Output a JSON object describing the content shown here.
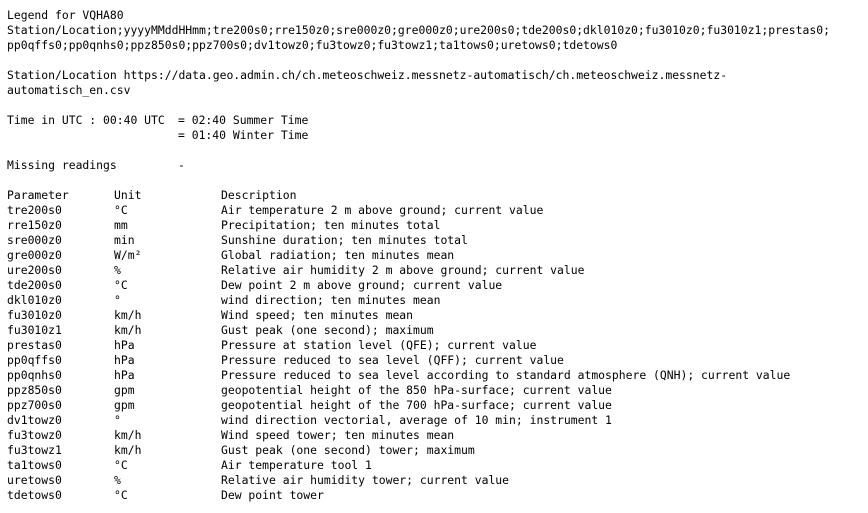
{
  "legend_title": "Legend for VQHA80",
  "station_format_line1": "Station/Location;yyyyMMddHHmm;tre200s0;rre150z0;sre000z0;gre000z0;ure200s0;tde200s0;dkl010z0;fu3010z0;fu3010z1;prestas0;",
  "station_format_line2": "pp0qffs0;pp0qnhs0;ppz850s0;ppz700s0;dv1towz0;fu3towz0;fu3towz1;ta1tows0;uretows0;tdetows0",
  "station_location_line1": "Station/Location https://data.geo.admin.ch/ch.meteoschweiz.messnetz-automatisch/ch.meteoschweiz.messnetz-",
  "station_location_line2": "automatisch_en.csv",
  "time": {
    "label": "Time in UTC : 00:40 UTC",
    "summer": "= 02:40 Summer Time",
    "winter": "= 01:40 Winter Time"
  },
  "missing": {
    "label": "Missing readings",
    "value": "-"
  },
  "table": {
    "headers": {
      "parameter": "Parameter",
      "unit": "Unit",
      "description": "Description"
    },
    "rows": [
      {
        "parameter": "tre200s0",
        "unit": "°C",
        "description": "Air temperature 2 m above ground; current value"
      },
      {
        "parameter": "rre150z0",
        "unit": "mm",
        "description": "Precipitation; ten minutes total"
      },
      {
        "parameter": "sre000z0",
        "unit": "min",
        "description": "Sunshine duration; ten minutes total"
      },
      {
        "parameter": "gre000z0",
        "unit": "W/m²",
        "description": "Global radiation; ten minutes mean"
      },
      {
        "parameter": "ure200s0",
        "unit": "%",
        "description": "Relative air humidity 2 m above ground; current value"
      },
      {
        "parameter": "tde200s0",
        "unit": "°C",
        "description": "Dew point 2 m above ground; current value"
      },
      {
        "parameter": "dkl010z0",
        "unit": "°",
        "description": "wind direction; ten minutes mean"
      },
      {
        "parameter": "fu3010z0",
        "unit": "km/h",
        "description": "Wind speed; ten minutes mean"
      },
      {
        "parameter": "fu3010z1",
        "unit": "km/h",
        "description": "Gust peak (one second); maximum"
      },
      {
        "parameter": "prestas0",
        "unit": "hPa",
        "description": "Pressure at station level (QFE); current value"
      },
      {
        "parameter": "pp0qffs0",
        "unit": "hPa",
        "description": "Pressure reduced to sea level (QFF); current value"
      },
      {
        "parameter": "pp0qnhs0",
        "unit": "hPa",
        "description": "Pressure reduced to sea level according to standard atmosphere (QNH); current value"
      },
      {
        "parameter": "ppz850s0",
        "unit": "gpm",
        "description": "geopotential height of the 850 hPa-surface; current value"
      },
      {
        "parameter": "ppz700s0",
        "unit": "gpm",
        "description": "geopotential height of the 700 hPa-surface; current value"
      },
      {
        "parameter": "dv1towz0",
        "unit": "°",
        "description": "wind direction vectorial, average of 10 min; instrument 1"
      },
      {
        "parameter": "fu3towz0",
        "unit": "km/h",
        "description": "Wind speed tower; ten minutes mean"
      },
      {
        "parameter": "fu3towz1",
        "unit": "km/h",
        "description": "Gust peak (one second) tower; maximum"
      },
      {
        "parameter": "ta1tows0",
        "unit": "°C",
        "description": "Air temperature tool 1"
      },
      {
        "parameter": "uretows0",
        "unit": "%",
        "description": "Relative air humidity tower; current value"
      },
      {
        "parameter": "tdetows0",
        "unit": "°C",
        "description": "Dew point tower"
      }
    ]
  }
}
